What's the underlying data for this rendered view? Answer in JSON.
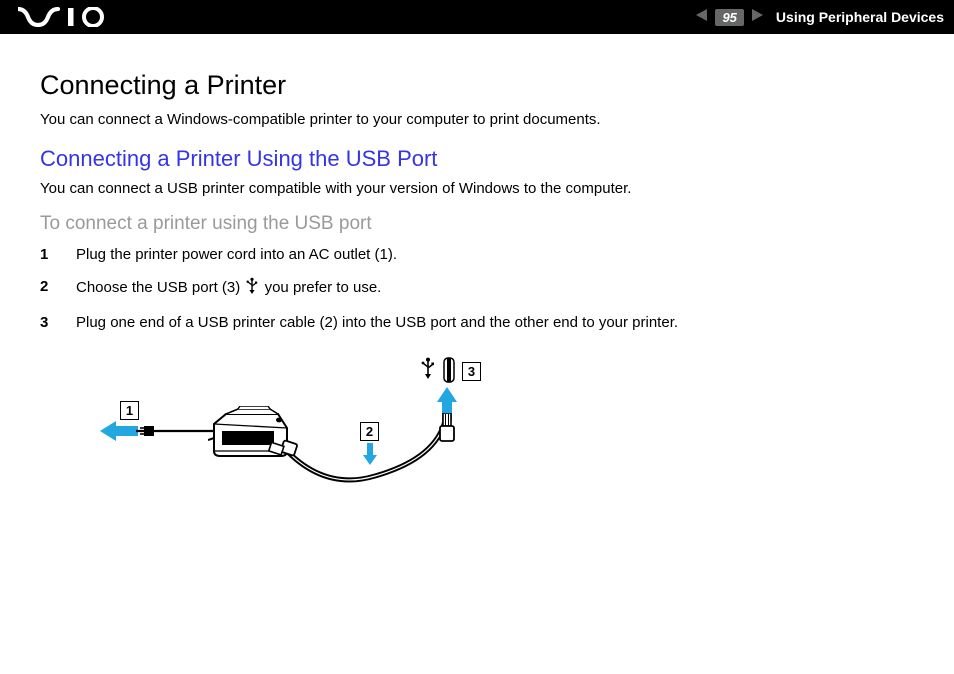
{
  "header": {
    "page_number": "95",
    "section_label": "Using Peripheral Devices"
  },
  "content": {
    "title": "Connecting a Printer",
    "intro": "You can connect a Windows-compatible printer to your computer to print documents.",
    "subtitle": "Connecting a Printer Using the USB Port",
    "sub_intro": "You can connect a USB printer compatible with your version of Windows to the computer.",
    "task_heading": "To connect a printer using the USB port",
    "steps": {
      "s1": "Plug the printer power cord into an AC outlet (1).",
      "s2a": "Choose the USB port (3) ",
      "s2b": " you prefer to use.",
      "s3": "Plug one end of a USB printer cable (2) into the USB port and the other end to your printer."
    },
    "callouts": {
      "c1": "1",
      "c2": "2",
      "c3": "3"
    }
  }
}
